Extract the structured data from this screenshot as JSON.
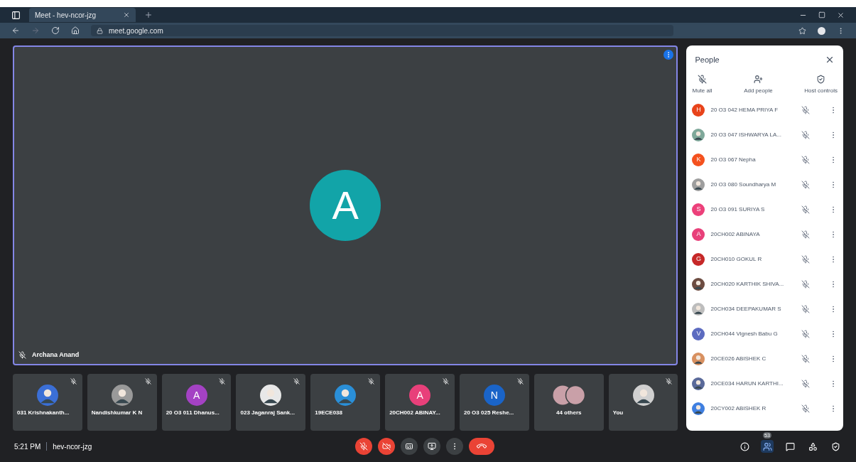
{
  "browser": {
    "tab_title": "Meet - hev-ncor-jzg",
    "url": "meet.google.com"
  },
  "stage": {
    "speaker": "Archana Anand",
    "letter": "A",
    "color": "#12a4a8",
    "muted": true
  },
  "tiles": [
    {
      "kind": "photo",
      "name": "031 Krishnakanth...",
      "color": "#3b6fd6",
      "muted": true
    },
    {
      "kind": "photo",
      "name": "Nandishkumar K N",
      "color": "#9a9a9a",
      "muted": true
    },
    {
      "kind": "letter",
      "letter": "A",
      "name": "20 O3 011 Dhanus...",
      "color": "#a442c4",
      "muted": true
    },
    {
      "kind": "photo",
      "name": "023 Jaganraj Sank...",
      "color": "#e8e8e8",
      "muted": true
    },
    {
      "kind": "photo",
      "name": "19ECE038",
      "color": "#2a8fd8",
      "muted": true
    },
    {
      "kind": "letter",
      "letter": "A",
      "name": "20CH002 ABINAY...",
      "color": "#e8407a",
      "muted": true
    },
    {
      "kind": "letter",
      "letter": "N",
      "name": "20 O3 025 Reshe...",
      "color": "#1a64c8",
      "muted": true
    },
    {
      "kind": "others",
      "name": "44 others",
      "color": "#c9a0a8",
      "muted": false
    },
    {
      "kind": "photo",
      "name": "You",
      "color": "#d0d0d0",
      "muted": true
    }
  ],
  "meeting": {
    "time": "5:21 PM",
    "code": "hev-ncor-jzg"
  },
  "controls": [
    {
      "kind": "mic",
      "on": false
    },
    {
      "kind": "camera",
      "on": false
    },
    {
      "kind": "captions",
      "on": false
    },
    {
      "kind": "present",
      "on": false
    },
    {
      "kind": "more"
    },
    {
      "kind": "leave"
    }
  ],
  "side_controls": [
    {
      "kind": "info",
      "selected": false
    },
    {
      "kind": "people",
      "selected": true,
      "badge": "53"
    },
    {
      "kind": "chat",
      "selected": false
    },
    {
      "kind": "activities",
      "selected": false
    },
    {
      "kind": "host",
      "selected": false
    }
  ],
  "people": {
    "title": "People",
    "actions": [
      {
        "kind": "mute",
        "label": "Mute all"
      },
      {
        "kind": "add",
        "label": "Add people"
      },
      {
        "kind": "host",
        "label": "Host controls"
      }
    ],
    "participants": [
      {
        "kind": "letter",
        "letter": "H",
        "name": "20 O3 042 HEMA PRIYA F",
        "color": "#e8431a",
        "muted": true
      },
      {
        "kind": "photo",
        "name": "20 O3 047 ISHWARYA LA...",
        "color": "#7fa89a",
        "muted": true
      },
      {
        "kind": "letter",
        "letter": "K",
        "name": "20 O3 067 Nepha",
        "color": "#f4511e",
        "muted": true
      },
      {
        "kind": "photo",
        "name": "20 O3 080 Soundharya M",
        "color": "#9e9e9e",
        "muted": true
      },
      {
        "kind": "letter",
        "letter": "S",
        "name": "20 O3 091 SURIYA S",
        "color": "#ec407a",
        "muted": true
      },
      {
        "kind": "letter",
        "letter": "A",
        "name": "20CH002 ABINAYA",
        "color": "#e8407a",
        "muted": true
      },
      {
        "kind": "letter",
        "letter": "G",
        "name": "20CH010 GOKUL R",
        "color": "#c62828",
        "muted": true
      },
      {
        "kind": "photo",
        "name": "20CH020 KARTHIK SHIVA...",
        "color": "#6d4c41",
        "muted": true
      },
      {
        "kind": "photo",
        "name": "20CH034 DEEPAKUMAR S",
        "color": "#bdbdbd",
        "muted": true
      },
      {
        "kind": "letter",
        "letter": "V",
        "name": "20CH044 Vignesh Babu G",
        "color": "#5c6bc0",
        "muted": true
      },
      {
        "kind": "photo",
        "name": "20CE026 ABISHEK C",
        "color": "#d89060",
        "muted": true
      },
      {
        "kind": "photo",
        "name": "20CE034 HARUN KARTHI...",
        "color": "#5a6a9a",
        "muted": true
      },
      {
        "kind": "photo",
        "name": "20CY002 ABISHEK R",
        "color": "#3f7fe0",
        "muted": true
      }
    ]
  }
}
